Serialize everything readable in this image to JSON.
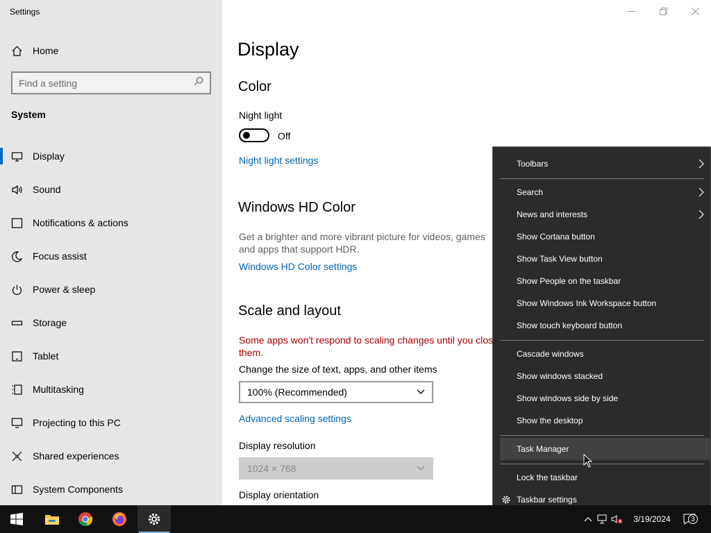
{
  "window": {
    "app_title": "Settings"
  },
  "sidebar": {
    "home_label": "Home",
    "search_placeholder": "Find a setting",
    "section_title": "System",
    "items": [
      {
        "label": "Display",
        "icon": "monitor-icon",
        "selected": true
      },
      {
        "label": "Sound",
        "icon": "speaker-icon"
      },
      {
        "label": "Notifications & actions",
        "icon": "notification-icon"
      },
      {
        "label": "Focus assist",
        "icon": "moon-icon"
      },
      {
        "label": "Power & sleep",
        "icon": "power-icon"
      },
      {
        "label": "Storage",
        "icon": "storage-icon"
      },
      {
        "label": "Tablet",
        "icon": "tablet-icon"
      },
      {
        "label": "Multitasking",
        "icon": "multitasking-icon"
      },
      {
        "label": "Projecting to this PC",
        "icon": "projecting-icon"
      },
      {
        "label": "Shared experiences",
        "icon": "shared-icon"
      },
      {
        "label": "System Components",
        "icon": "components-icon"
      }
    ]
  },
  "main": {
    "page_title": "Display",
    "color": {
      "heading": "Color",
      "night_light_label": "Night light",
      "night_light_state": "Off",
      "night_light_link": "Night light settings"
    },
    "hd_color": {
      "heading": "Windows HD Color",
      "description": "Get a brighter and more vibrant picture for videos, games and apps that support HDR.",
      "link": "Windows HD Color settings"
    },
    "scale": {
      "heading": "Scale and layout",
      "warning": "Some apps won't respond to scaling changes until you close them.",
      "size_label": "Change the size of text, apps, and other items",
      "size_value": "100% (Recommended)",
      "advanced_link": "Advanced scaling settings",
      "resolution_label": "Display resolution",
      "resolution_value": "1024 × 768",
      "orientation_label": "Display orientation"
    }
  },
  "context_menu": {
    "items": {
      "toolbars": "Toolbars",
      "search": "Search",
      "news": "News and interests",
      "cortana": "Show Cortana button",
      "task_view": "Show Task View button",
      "people": "Show People on the taskbar",
      "ink": "Show Windows Ink Workspace button",
      "touch_keyboard": "Show touch keyboard button",
      "cascade": "Cascade windows",
      "stacked": "Show windows stacked",
      "side_by_side": "Show windows side by side",
      "desktop": "Show the desktop",
      "task_manager": "Task Manager",
      "lock": "Lock the taskbar",
      "taskbar_settings": "Taskbar settings"
    },
    "hovered": "Task Manager"
  },
  "taskbar": {
    "date": "3/19/2024",
    "notification_count": "3",
    "apps": [
      "windows-start-icon",
      "file-explorer-icon",
      "chrome-icon",
      "firefox-icon",
      "settings-gear-icon"
    ]
  },
  "colors": {
    "accent": "#0067c0",
    "link": "#0063b1",
    "warning": "#a80000",
    "menu_bg": "#2b2b2b",
    "taskbar_bg": "#111111"
  }
}
